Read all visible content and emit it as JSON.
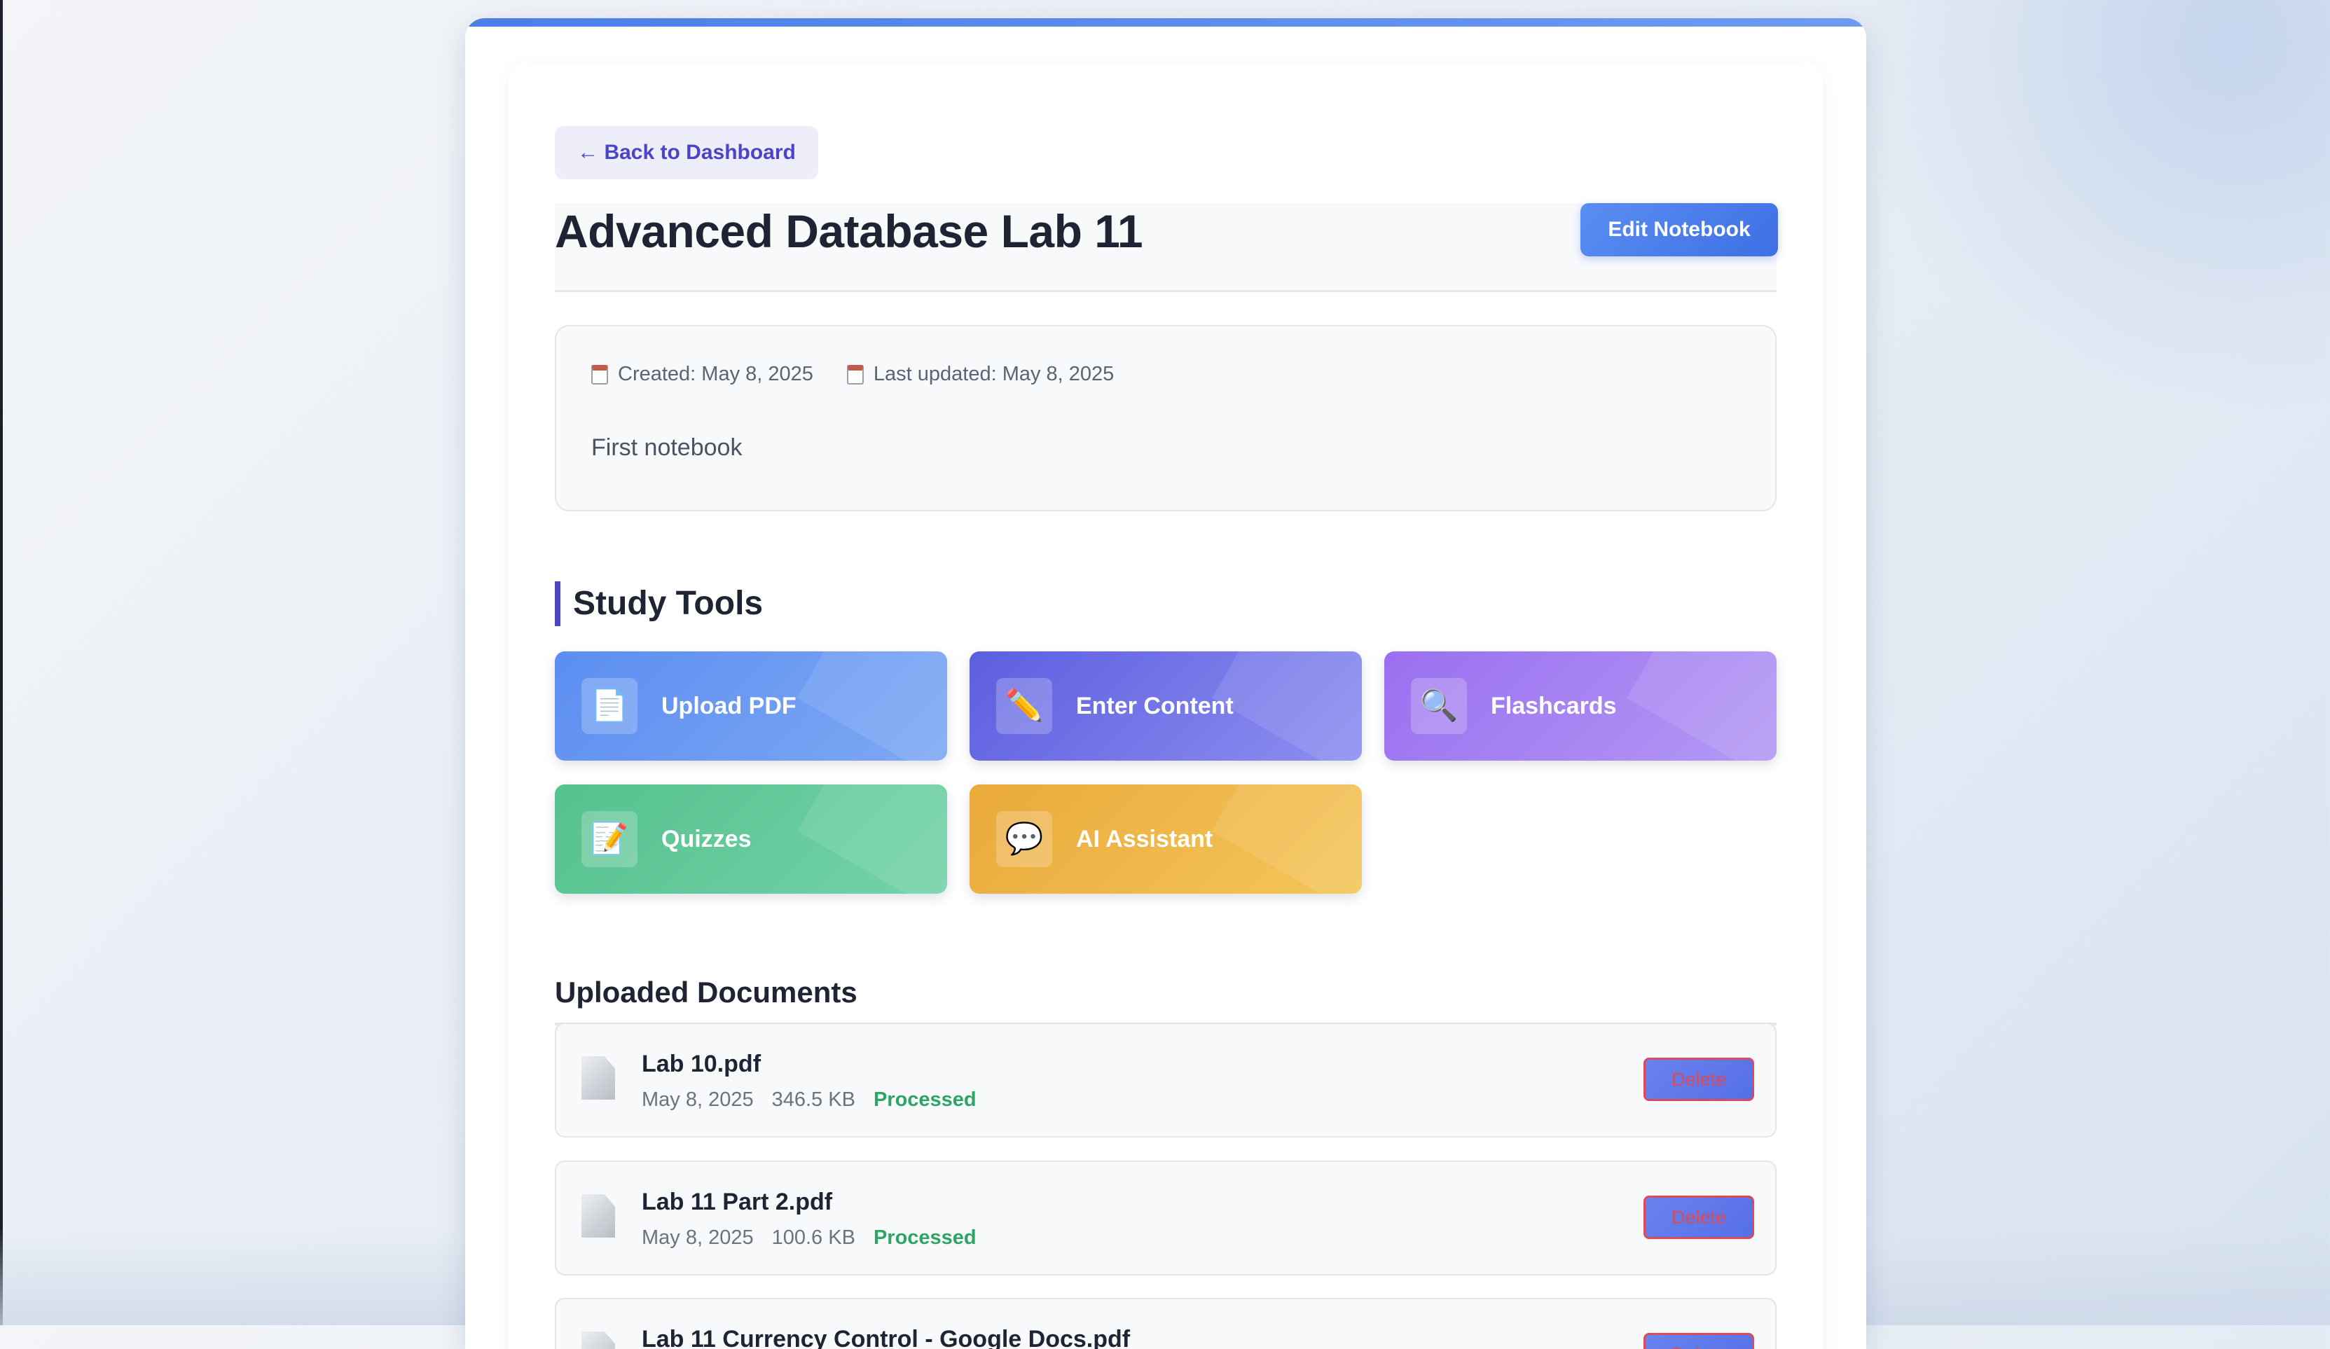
{
  "page": {
    "back_label": "← Back to Dashboard",
    "title": "Advanced Database Lab 11",
    "edit_label": "Edit Notebook"
  },
  "info": {
    "created": "Created: May 8, 2025",
    "updated": "Last updated: May 8, 2025",
    "description": "First notebook"
  },
  "study_tools": {
    "heading": "Study Tools",
    "items": [
      {
        "label": "Upload PDF",
        "icon": "📄",
        "icon_name": "document-icon"
      },
      {
        "label": "Enter Content",
        "icon": "✏️",
        "icon_name": "pencil-icon"
      },
      {
        "label": "Flashcards",
        "icon": "🔍",
        "icon_name": "magnifier-icon"
      },
      {
        "label": "Quizzes",
        "icon": "📝",
        "icon_name": "memo-icon"
      },
      {
        "label": "AI Assistant",
        "icon": "💬",
        "icon_name": "speech-bubble-icon"
      }
    ]
  },
  "documents": {
    "heading": "Uploaded Documents",
    "delete_label": "Delete",
    "items": [
      {
        "name": "Lab 10.pdf",
        "date": "May 8, 2025",
        "size": "346.5 KB",
        "status": "Processed"
      },
      {
        "name": "Lab 11 Part 2.pdf",
        "date": "May 8, 2025",
        "size": "100.6 KB",
        "status": "Processed"
      },
      {
        "name": "Lab 11 Currency Control - Google Docs.pdf"
      }
    ]
  },
  "colors": {
    "accent": "#4b44c6",
    "primary_button": "#4a7de8",
    "success": "#2fa565",
    "danger": "#d94b5a"
  }
}
